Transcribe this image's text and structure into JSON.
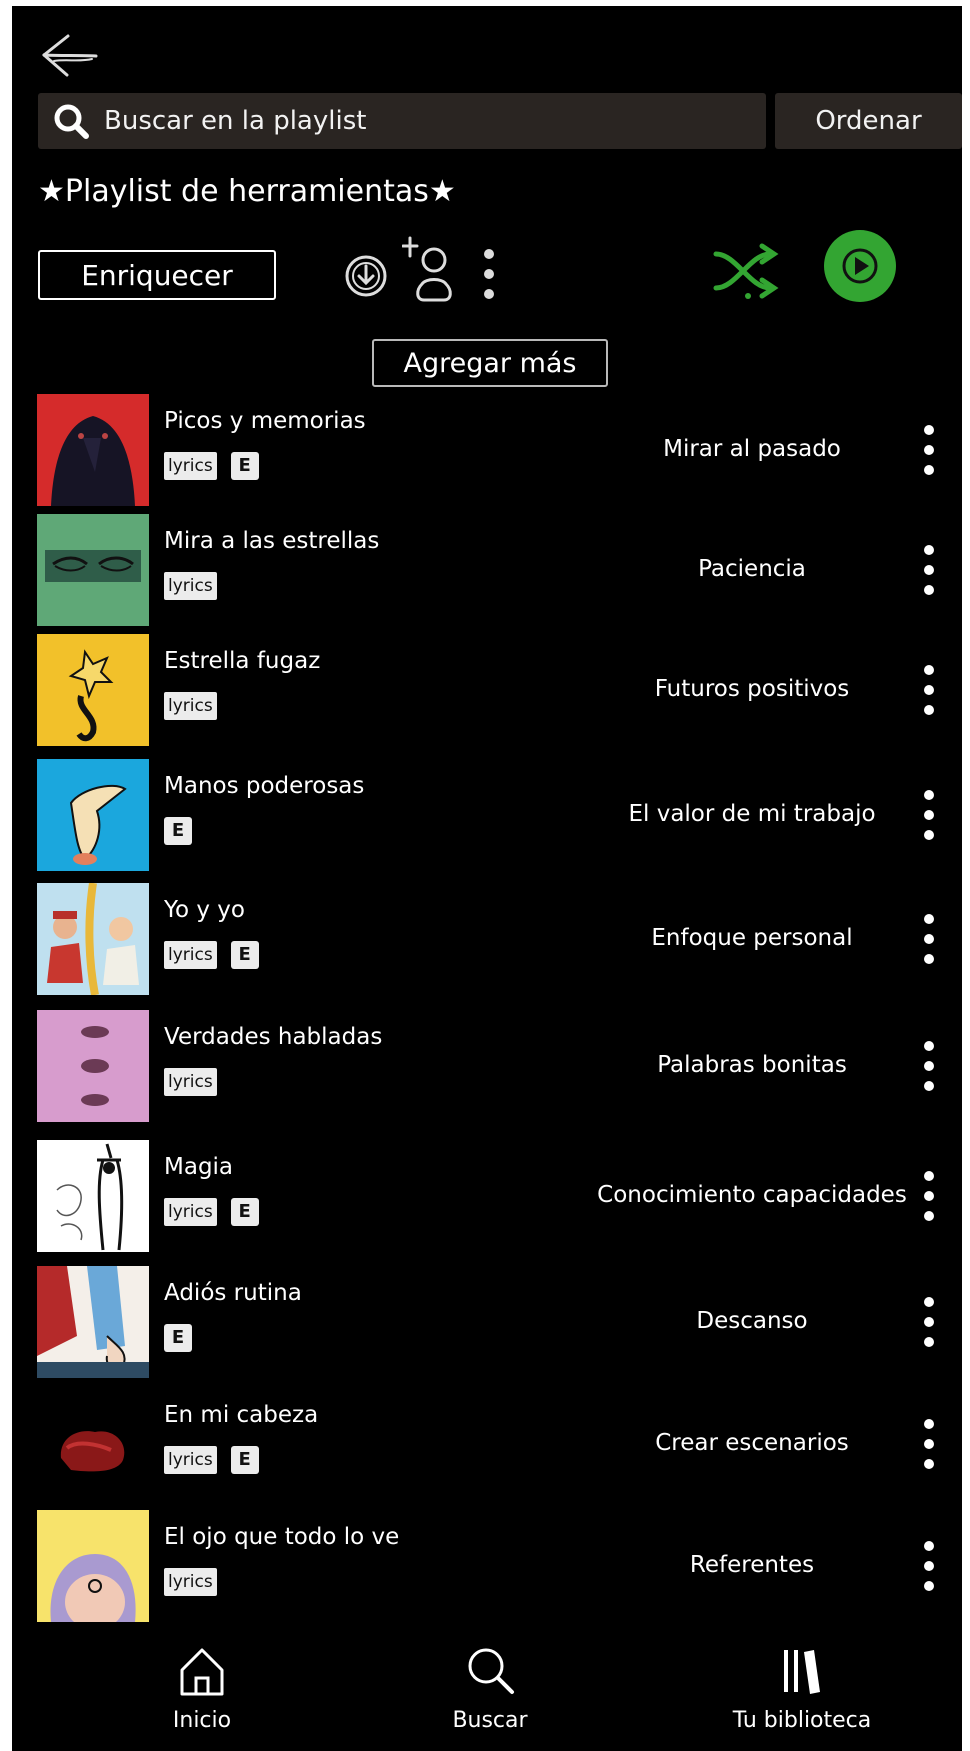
{
  "header": {
    "back_icon": "arrow-left-icon",
    "search": {
      "placeholder": "Buscar en la playlist",
      "icon": "search-icon"
    },
    "sort_label": "Ordenar"
  },
  "playlist": {
    "title": "★Playlist de herramientas★",
    "enrich_label": "Enriquecer",
    "add_more_label": "Agregar más",
    "accent_color": "#33a532"
  },
  "tracks": [
    {
      "title": "Picos y memorias",
      "lyrics": "lyrics",
      "explicit": "E",
      "tag": "Mirar al pasado"
    },
    {
      "title": "Mira a las estrellas",
      "lyrics": "lyrics",
      "tag": "Paciencia"
    },
    {
      "title": "Estrella fugaz",
      "lyrics": "lyrics",
      "tag": "Futuros positivos"
    },
    {
      "title": "Manos poderosas",
      "explicit": "E",
      "tag": "El valor de mi trabajo"
    },
    {
      "title": "Yo y yo",
      "lyrics": "lyrics",
      "explicit": "E",
      "tag": "Enfoque personal"
    },
    {
      "title": "Verdades habladas",
      "lyrics": "lyrics",
      "tag": "Palabras bonitas"
    },
    {
      "title": "Magia",
      "lyrics": "lyrics",
      "explicit": "E",
      "tag": "Conocimiento capacidades"
    },
    {
      "title": "Adiós rutina",
      "explicit": "E",
      "tag": "Descanso"
    },
    {
      "title": "En mi cabeza",
      "lyrics": "lyrics",
      "explicit": "E",
      "tag": "Crear escenarios"
    },
    {
      "title": "El ojo que todo lo ve",
      "lyrics": "lyrics",
      "tag": "Referentes"
    }
  ],
  "bottom_nav": {
    "home": "Inicio",
    "search": "Buscar",
    "library": "Tu biblioteca"
  }
}
